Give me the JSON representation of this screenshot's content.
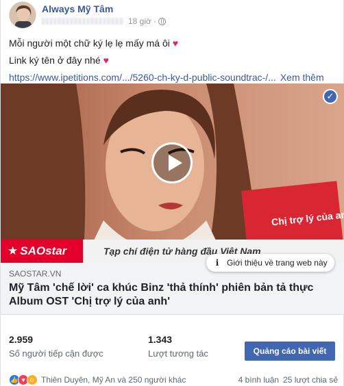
{
  "header": {
    "page_name": "Always Mỹ Tâm",
    "time": "18 giờ",
    "separator": "·"
  },
  "post": {
    "line1": "Mỗi người một chữ ký lẹ lẹ mấy má ôi",
    "line2": "Link ký tên ở đây nhé",
    "heart": "♥",
    "link_text": "https://www.ipetitions.com/.../5260-ch-ky-d-public-soundtrac-/...",
    "see_more": "Xem thêm"
  },
  "media": {
    "banner_logo": "SAOstar",
    "banner_text": "Tạp chí điện tử hàng đầu Việt Nam",
    "book_text": "Chị trợ lý của anh"
  },
  "tooltip": {
    "text": "Giới thiệu về trang web này",
    "icon": "info-icon"
  },
  "preview": {
    "source": "SAOSTAR.VN",
    "headline": "Mỹ Tâm 'chế lời' ca khúc Binz 'thả thính' phiên bản tả thực Album OST 'Chị trợ lý của anh'"
  },
  "stats": {
    "reach_value": "2.959",
    "reach_label": "Số người tiếp cận được",
    "engagement_value": "1.343",
    "engagement_label": "Lượt tương tác",
    "boost_label": "Quảng cáo bài viết"
  },
  "reactions": {
    "names": "Thiên Duyên, Mỹ An và 250 người khác",
    "comments": "4 bình luận",
    "shares": "25 lượt chia sẻ"
  },
  "colors": {
    "link": "#385898",
    "button": "#4267b2",
    "brand_red": "#e4002b"
  }
}
